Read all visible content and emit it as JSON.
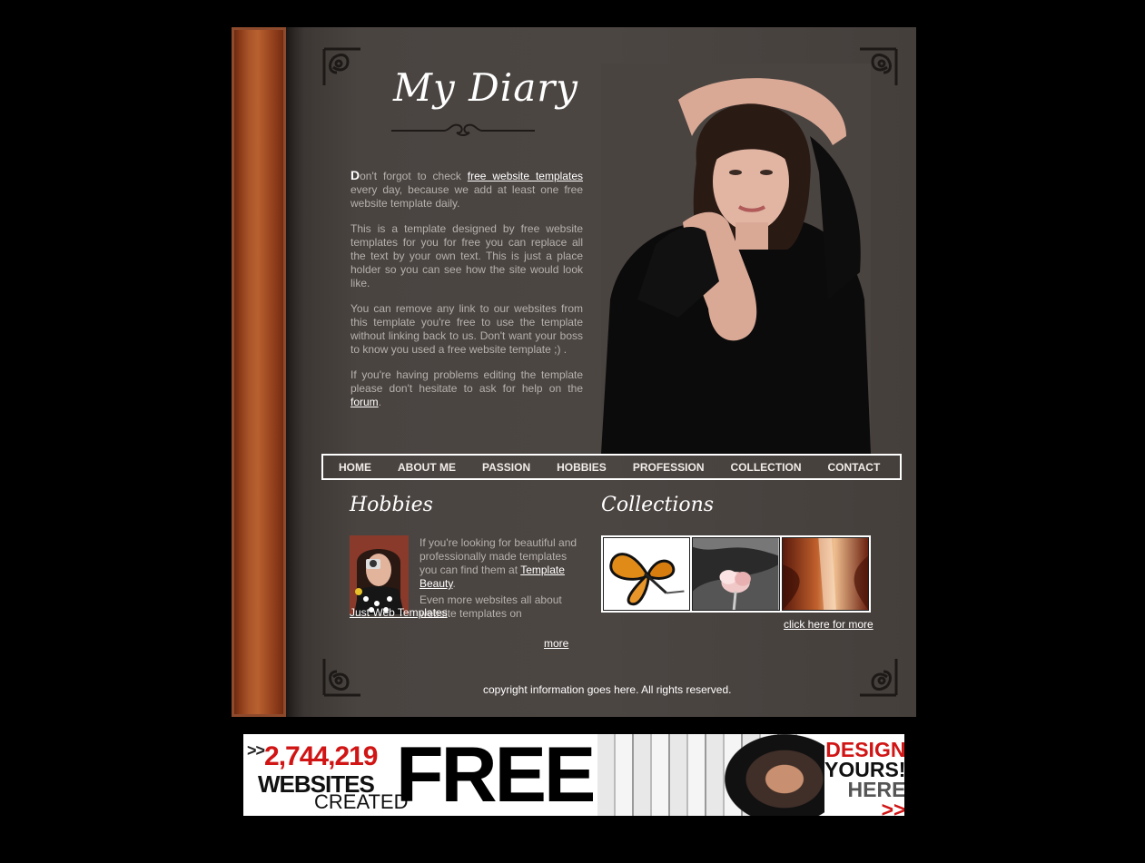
{
  "header": {
    "title": "My Diary"
  },
  "intro": {
    "p1_dropcap": "D",
    "p1_before_link": "on't forgot to check ",
    "p1_link": "free website templates",
    "p1_after_link": " every day, because we add at least one free website template daily.",
    "p2": "This is a template designed by free website templates for you for free you can replace all the text by your own text. This is just a place holder so you can see how the site would look like.",
    "p3": "You can remove any link to our websites from this template you're free to use the template without linking back to us. Don't want your boss to know you used a free website template ;) .",
    "p4_before_link": "If you're having problems editing the template please don't hesitate to ask for help on the ",
    "p4_link": "forum",
    "p4_after_link": "."
  },
  "nav": {
    "items": [
      "HOME",
      "ABOUT ME",
      "PASSION",
      "HOBBIES",
      "PROFESSION",
      "COLLECTION",
      "CONTACT"
    ]
  },
  "hobbies": {
    "title": "Hobbies",
    "text1": "If you're looking for beautiful and professionally made templates you can find them at ",
    "link1": "Template Beauty",
    "after_link1": ".",
    "text2": "Even more websites all about website templates on ",
    "link2": "Just Web Templates",
    "after_link2": ".",
    "more": "more"
  },
  "collections": {
    "title": "Collections",
    "click_more": "click here for more"
  },
  "footer": {
    "copyright": "copyright information goes here. All rights reserved."
  },
  "banner": {
    "count": "2,744,219",
    "arrows": ">>",
    "websites": "WEBSITES",
    "created": "CREATED",
    "free": "FREE",
    "design": "DESIGN",
    "yours": "YOURS!",
    "here": "HERE",
    "here_arrows": ">>"
  }
}
